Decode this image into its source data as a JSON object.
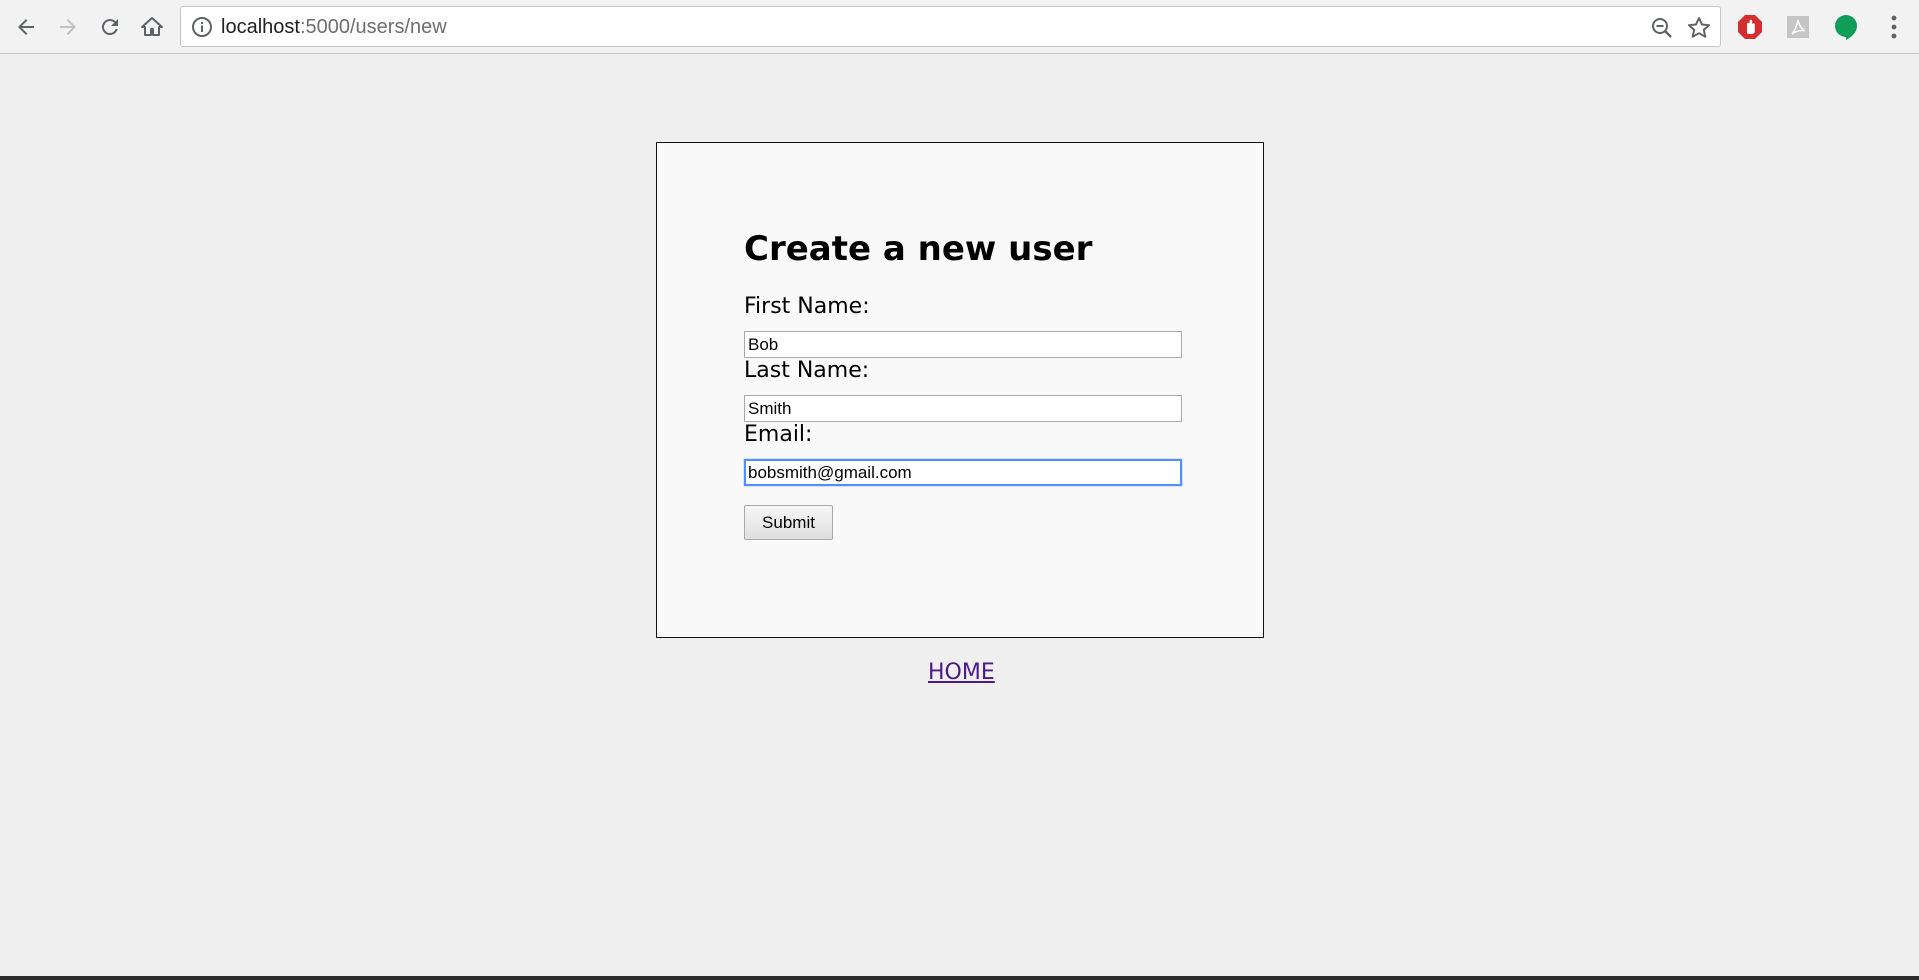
{
  "browser": {
    "url_host": "localhost",
    "url_path": ":5000/users/new",
    "icons": {
      "back": "back-arrow-icon",
      "forward": "forward-arrow-icon",
      "reload": "reload-icon",
      "home": "home-icon",
      "info": "info-icon",
      "zoom": "zoom-out-icon",
      "bookmark": "star-icon",
      "extensions": [
        "adblock-icon",
        "pdf-icon",
        "hangouts-icon"
      ],
      "menu": "menu-dots-icon"
    },
    "colors": {
      "adblock": "#d32f2f",
      "pdf": "#c5c5c5",
      "hangouts": "#0f9d58"
    }
  },
  "form": {
    "title": "Create a new user",
    "first_name": {
      "label": "First Name:",
      "value": "Bob"
    },
    "last_name": {
      "label": "Last Name:",
      "value": "Smith"
    },
    "email": {
      "label": "Email:",
      "value": "bobsmith@gmail.com"
    },
    "submit_label": "Submit"
  },
  "footer": {
    "home_link": "HOME"
  }
}
